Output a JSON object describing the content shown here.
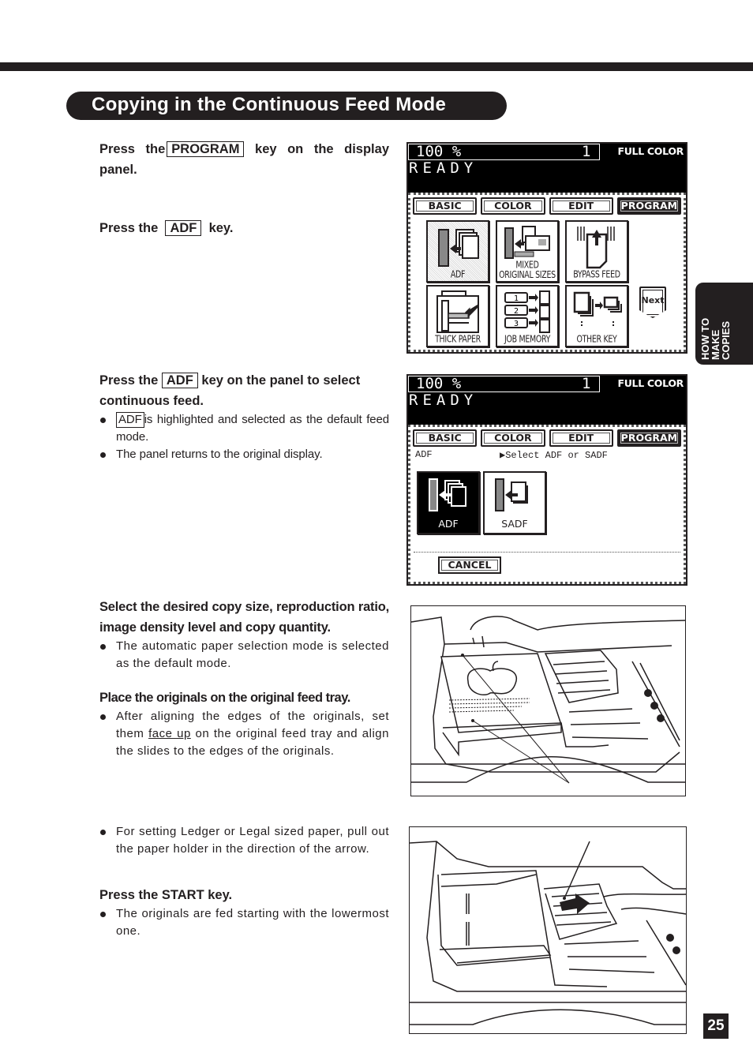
{
  "page": {
    "title": "Copying in the Continuous Feed Mode",
    "side_tab": [
      "HOW TO",
      "MAKE",
      "COPIES"
    ],
    "page_number": "25"
  },
  "steps": {
    "s1": {
      "prefix": "Press the",
      "key": "PROGRAM",
      "suffix": "key on the display panel."
    },
    "s2": {
      "prefix": "Press the",
      "key": "ADF",
      "suffix": "key."
    },
    "s3": {
      "prefix": "Press the",
      "key": "ADF",
      "suffix": "key on the panel to select continuous feed.",
      "bullet1_key": "ADF",
      "bullet1_text": "is highlighted and selected as the default feed mode.",
      "bullet2": "The panel returns to the original display."
    },
    "s4": {
      "heading": "Select the desired copy size, reproduction ratio, image density level and copy quantity.",
      "bullet1": "The automatic paper selection mode is selected as the default mode."
    },
    "s5": {
      "heading": "Place the originals on the original feed tray.",
      "bullet1_before": "After aligning the edges of the originals, set them",
      "bullet1_underline": "face up",
      "bullet1_after": "on the original feed tray and align the slides to the edges of the originals."
    },
    "s6": {
      "bullet1": "For setting Ledger or Legal sized paper, pull out the paper holder in the direction of the arrow."
    },
    "s7": {
      "heading": "Press the START key.",
      "bullet1": "The originals are fed starting with the lowermost one."
    }
  },
  "panel1": {
    "ratio": "100  %",
    "quantity": "1",
    "color_mode": "FULL COLOR",
    "status": "READY",
    "tabs": [
      "BASIC",
      "COLOR",
      "EDIT",
      "PROGRAM"
    ],
    "active_tab": "PROGRAM",
    "keys": [
      {
        "label": "ADF",
        "icon": "adf-icon"
      },
      {
        "label": "MIXED\nORIGINAL SIZES",
        "label1": "MIXED",
        "label2": "ORIGINAL SIZES",
        "icon": "mixed-sizes-icon"
      },
      {
        "label": "BYPASS FEED",
        "icon": "bypass-feed-icon"
      },
      {
        "label": "THICK PAPER",
        "icon": "thick-paper-icon"
      },
      {
        "label": "JOB MEMORY",
        "icon": "job-memory-icon",
        "numbers": [
          "1",
          "2",
          "3"
        ]
      },
      {
        "label": "OTHER KEY",
        "icon": "other-key-icon"
      }
    ],
    "next_label": "Next"
  },
  "panel2": {
    "ratio": "100  %",
    "quantity": "1",
    "color_mode": "FULL COLOR",
    "status": "READY",
    "tabs": [
      "BASIC",
      "COLOR",
      "EDIT",
      "PROGRAM"
    ],
    "active_tab": "PROGRAM",
    "section_label": "ADF",
    "hint": "▶Select ADF or SADF",
    "options": [
      {
        "label": "ADF",
        "selected": true
      },
      {
        "label": "SADF",
        "selected": false
      }
    ],
    "cancel_label": "CANCEL"
  },
  "colors": {
    "ink": "#231f20",
    "paper": "#ffffff"
  }
}
